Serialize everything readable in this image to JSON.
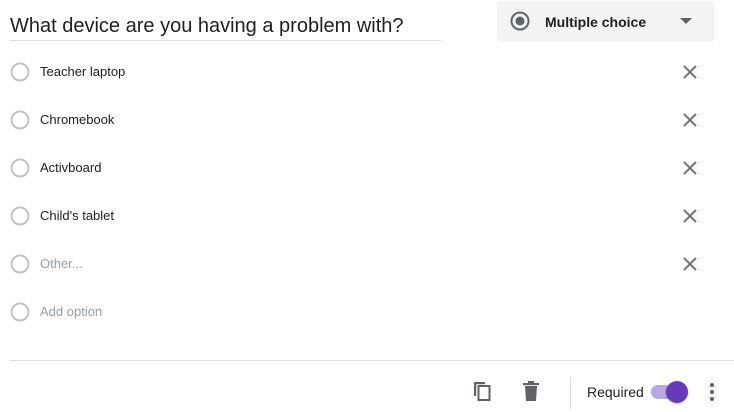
{
  "question": {
    "title": "What device are you having a problem with?"
  },
  "type_dropdown": {
    "selected": "Multiple choice",
    "icon": "radio-button-checked-icon"
  },
  "options": [
    {
      "label": "Teacher laptop"
    },
    {
      "label": "Chromebook"
    },
    {
      "label": "Activboard"
    },
    {
      "label": "Child's tablet"
    }
  ],
  "other_option": {
    "placeholder": "Other..."
  },
  "add_option": {
    "label": "Add option"
  },
  "footer": {
    "required_label": "Required",
    "required_on": true
  },
  "colors": {
    "accent": "#673ab7",
    "accent_track": "#b7a7e2",
    "icon_gray": "#5f6368",
    "placeholder_gray": "#9aa0a6",
    "divider": "#dadce0"
  }
}
